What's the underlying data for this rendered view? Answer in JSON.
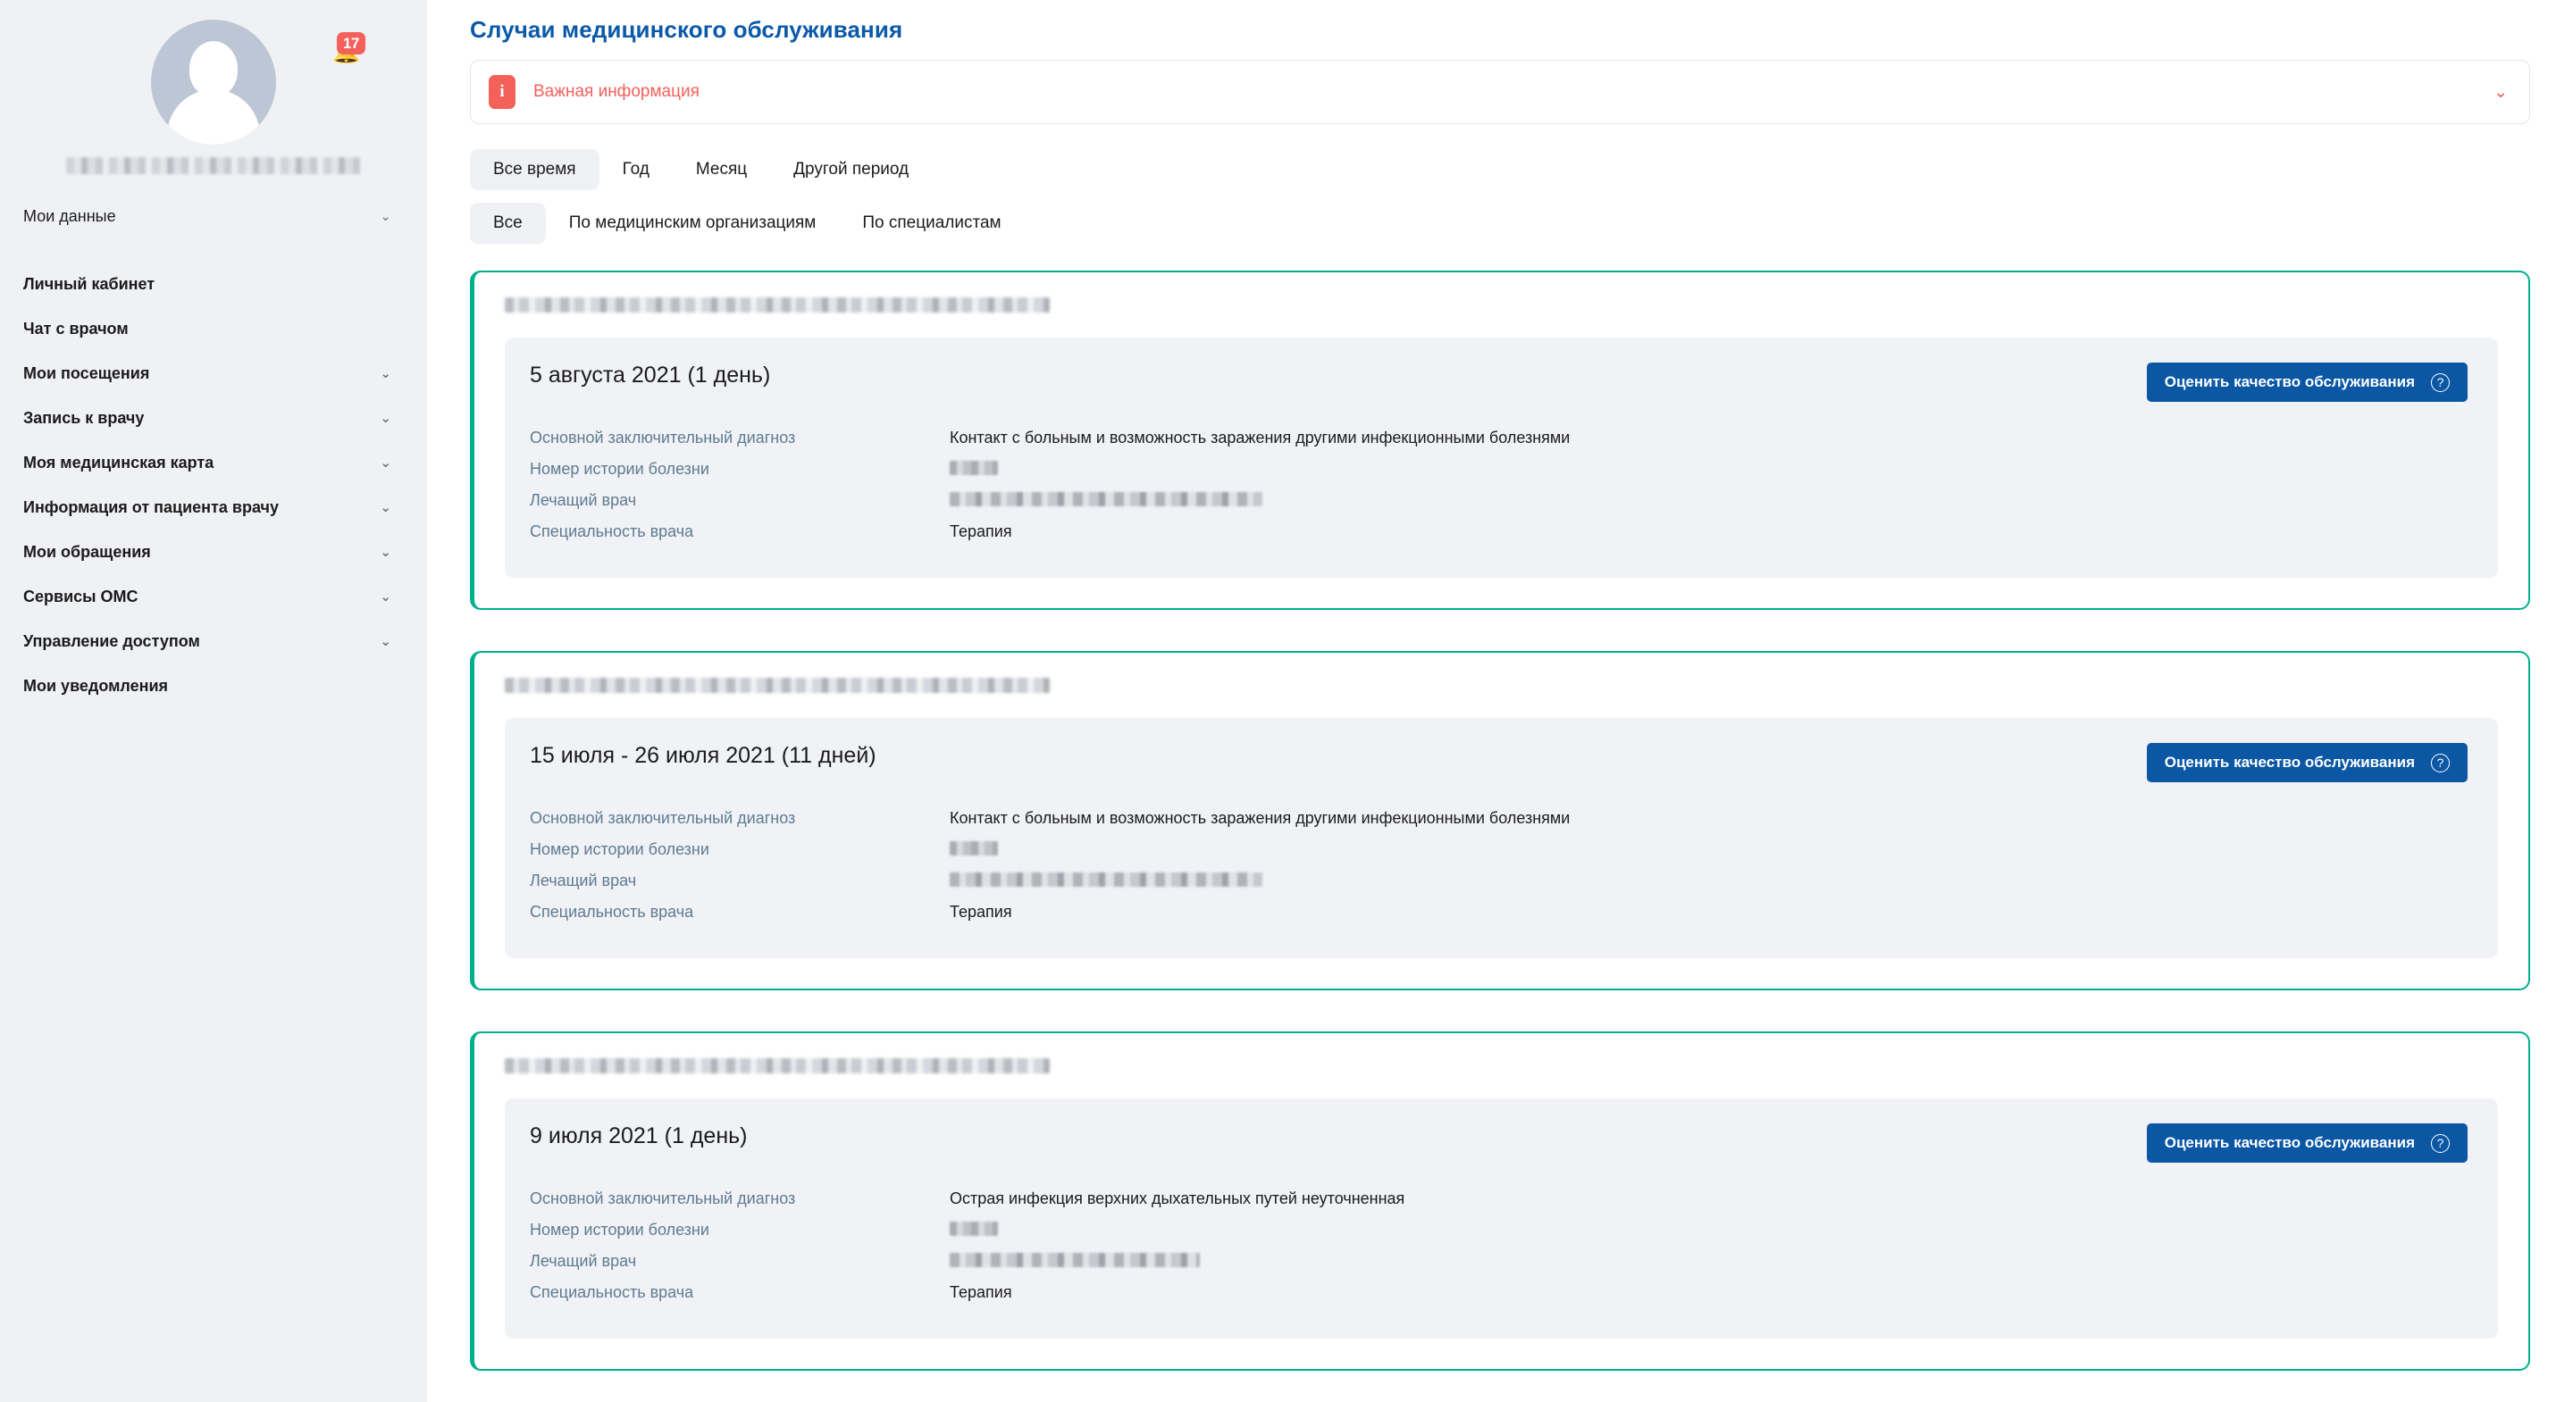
{
  "sidebar": {
    "notification_count": "17",
    "bell_icon": "bell-icon",
    "avatar_icon": "avatar-placeholder-icon",
    "items": [
      {
        "label": "Мои данные",
        "chevron": "⌄",
        "bold": false
      },
      {
        "label": "Личный кабинет",
        "chevron": "",
        "bold": true
      },
      {
        "label": "Чат с врачом",
        "chevron": "",
        "bold": true
      },
      {
        "label": "Мои посещения",
        "chevron": "⌄",
        "bold": true
      },
      {
        "label": "Запись к врачу",
        "chevron": "⌄",
        "bold": true
      },
      {
        "label": "Моя медицинская карта",
        "chevron": "⌄",
        "bold": true
      },
      {
        "label": "Информация от пациента врачу",
        "chevron": "⌄",
        "bold": true
      },
      {
        "label": "Мои обращения",
        "chevron": "⌄",
        "bold": true
      },
      {
        "label": "Сервисы ОМС",
        "chevron": "⌄",
        "bold": true
      },
      {
        "label": "Управление доступом",
        "chevron": "⌄",
        "bold": true
      },
      {
        "label": "Мои уведомления",
        "chevron": "",
        "bold": true
      }
    ]
  },
  "header": {
    "title": "Случаи медицинского обслуживания"
  },
  "alert": {
    "icon_glyph": "i",
    "text": "Важная информация",
    "chevron": "⌄"
  },
  "period_tabs": [
    {
      "label": "Все время",
      "active": true
    },
    {
      "label": "Год",
      "active": false
    },
    {
      "label": "Месяц",
      "active": false
    },
    {
      "label": "Другой период",
      "active": false
    }
  ],
  "group_tabs": [
    {
      "label": "Все",
      "active": true
    },
    {
      "label": "По медицинским организациям",
      "active": false
    },
    {
      "label": "По специалистам",
      "active": false
    }
  ],
  "labels": {
    "diagnosis": "Основной заключительный диагноз",
    "case_number": "Номер истории болезни",
    "doctor": "Лечащий врач",
    "specialty": "Специальность врача"
  },
  "rate_button": {
    "label": "Оценить качество обслуживания",
    "help_icon": "question-mark-icon"
  },
  "colors": {
    "accent_blue": "#0B59A8",
    "button_blue": "#0B57A4",
    "card_border_teal": "#00B08C",
    "alert_red": "#F4605A",
    "label_gray_blue": "#5E7B90",
    "sidebar_bg": "#F0F1F5",
    "panel_bg": "#F0F2F6"
  },
  "cases": [
    {
      "organization": "",
      "date": "5 августа 2021 (1 день)",
      "diagnosis": "Контакт с больным и возможность заражения другими инфекционными болезнями",
      "case_number": "",
      "doctor": "",
      "specialty": "Терапия"
    },
    {
      "organization": "",
      "date": "15 июля - 26 июля 2021 (11 дней)",
      "diagnosis": "Контакт с больным и возможность заражения другими инфекционными болезнями",
      "case_number": "",
      "doctor": "",
      "specialty": "Терапия"
    },
    {
      "organization": "",
      "date": "9 июля 2021 (1 день)",
      "diagnosis": "Острая инфекция верхних дыхательных путей неуточненная",
      "case_number": "",
      "doctor": "",
      "specialty": "Терапия"
    }
  ]
}
